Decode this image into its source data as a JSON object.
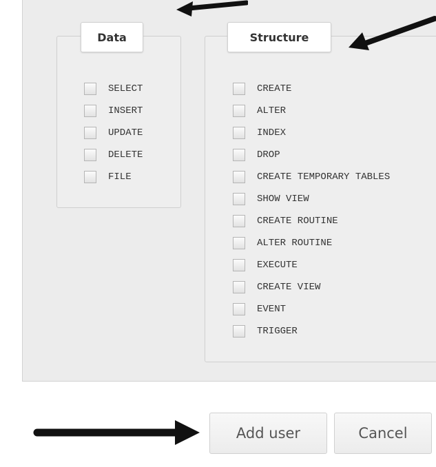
{
  "data_group": {
    "legend": "Data",
    "privileges": [
      "SELECT",
      "INSERT",
      "UPDATE",
      "DELETE",
      "FILE"
    ]
  },
  "structure_group": {
    "legend": "Structure",
    "privileges": [
      "CREATE",
      "ALTER",
      "INDEX",
      "DROP",
      "CREATE TEMPORARY TABLES",
      "SHOW VIEW",
      "CREATE ROUTINE",
      "ALTER ROUTINE",
      "EXECUTE",
      "CREATE VIEW",
      "EVENT",
      "TRIGGER"
    ]
  },
  "buttons": {
    "add_user": "Add user",
    "cancel": "Cancel"
  },
  "annotation_color": "#111111"
}
